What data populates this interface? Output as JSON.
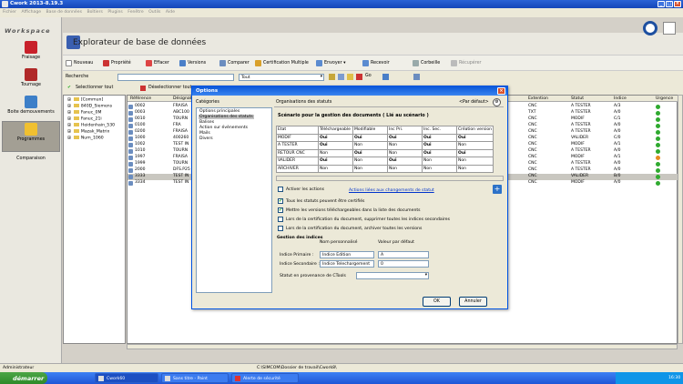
{
  "window": {
    "title": "Cwork 2013-8.19.3"
  },
  "menu": [
    "Fichier",
    "Affichage",
    "Base de données",
    "Boîtiers",
    "Plugins",
    "Fenêtre",
    "Outils",
    "Aide"
  ],
  "sidebar": {
    "workspace_label": "Workspace",
    "items": [
      {
        "label": "Fraisage",
        "icon": "milling-icon"
      },
      {
        "label": "Tournage",
        "icon": "turning-icon"
      },
      {
        "label": "Boite demouvements",
        "icon": "machine-icon"
      },
      {
        "label": "Programmes",
        "icon": "programs-folder-icon",
        "selected": true
      },
      {
        "label": "Comparaison",
        "icon": "compare-icon"
      }
    ]
  },
  "main": {
    "title": "Explorateur de base de données"
  },
  "toolbar": {
    "nouveau": "Nouveau",
    "propriete": "Propriété",
    "effacer": "Effacer",
    "versions": "Versions",
    "comparer": "Comparer",
    "certification": "Certification Multiple",
    "envoyer": "Envoyer",
    "recevoir": "Recevoir",
    "corbeille": "Corbeille",
    "recuperer": "Récupérer"
  },
  "search": {
    "label": "Recherche",
    "filter_value": "Tout",
    "go_label": "Go"
  },
  "selection": {
    "select_all": "Selectionner tout",
    "deselect_all": "Déselectionner tout"
  },
  "tree": [
    "[Commun]",
    "840D_Siemens",
    "Fanuc_0M",
    "Fanuc_21i",
    "Heidenhain_530",
    "Mazak_Matrix",
    "Num_1060"
  ],
  "grid": {
    "columns": {
      "reference": "Référence",
      "designation": "Désignati",
      "extension": "Extention",
      "statut": "Statut",
      "indice": "Indice",
      "urgence": "Urgence"
    },
    "rows": [
      {
        "ref": "0002",
        "des": "FRAISA",
        "ext": "CNC",
        "statut": "A TESTER",
        "indice": "A/3",
        "urg": "#2faa2f"
      },
      {
        "ref": "0003",
        "des": "ABC100",
        "ext": "TXT",
        "statut": "A TESTER",
        "indice": "A/0",
        "urg": "#2faa2f"
      },
      {
        "ref": "0010",
        "des": "TOURN",
        "ext": "CNC",
        "statut": "MODIF",
        "indice": "C/1",
        "urg": "#2faa2f"
      },
      {
        "ref": "0100",
        "des": "FRA",
        "ext": "CNC",
        "statut": "A TESTER",
        "indice": "A/0",
        "urg": "#2faa2f"
      },
      {
        "ref": "0200",
        "des": "FRAISA",
        "ext": "CNC",
        "statut": "A TESTER",
        "indice": "A/0",
        "urg": "#2faa2f"
      },
      {
        "ref": "1000",
        "des": "400260",
        "ext": "CNC",
        "statut": "VALIDER",
        "indice": "C/0",
        "urg": "#2faa2f"
      },
      {
        "ref": "1002",
        "des": "TEST IN",
        "ext": "CNC",
        "statut": "MODIF",
        "indice": "A/1",
        "urg": "#2faa2f"
      },
      {
        "ref": "1010",
        "des": "TOURN",
        "ext": "CNC",
        "statut": "A TESTER",
        "indice": "A/0",
        "urg": "#2faa2f"
      },
      {
        "ref": "1997",
        "des": "FRAISA",
        "ext": "CNC",
        "statut": "MODIF",
        "indice": "A/1",
        "urg": "#e68a1f"
      },
      {
        "ref": "1999",
        "des": "TOURN",
        "ext": "CNC",
        "statut": "A TESTER",
        "indice": "A/0",
        "urg": "#2faa2f"
      },
      {
        "ref": "2000",
        "des": "DFS.P25",
        "ext": "CNC",
        "statut": "A TESTER",
        "indice": "A/0",
        "urg": "#2faa2f"
      },
      {
        "ref": "3333",
        "des": "TEST IN",
        "ext": "CNC",
        "statut": "VALIDER",
        "indice": "B/0",
        "urg": "#2faa2f"
      },
      {
        "ref": "3334",
        "des": "TEST IN",
        "ext": "CNC",
        "statut": "MODIF",
        "indice": "A/0",
        "urg": "#2faa2f"
      }
    ]
  },
  "status": {
    "user": "Administrateur",
    "path": "C:\\SIMCOM\\Dossier de travail\\Cwork8\\"
  },
  "taskbar": {
    "start": "démarrer",
    "tasks": [
      "Cwork60",
      "Sans titre - Paint",
      "Alerte de sécurité"
    ],
    "clock": "16:30"
  },
  "dialog": {
    "title": "Options",
    "categories_label": "Catégories",
    "categories": [
      "Options principales",
      "Organisations des statuts",
      "Balises",
      "Action sur évènements",
      "Mails",
      "Divers"
    ],
    "selected_category": 1,
    "panel_title": "Organisations des statuts",
    "par_defaut": "<Par défaut>",
    "section_header": "Scénario pour la gestion des documents ( Lié au scénario )",
    "table": {
      "headers": [
        "Etat",
        "Téléchargeable",
        "Modifiable",
        "Inc Pri.",
        "Inc. Sec.",
        "Création version"
      ],
      "rows": [
        [
          "MODIF",
          "Oui",
          "Oui",
          "Oui",
          "Oui",
          "Oui"
        ],
        [
          "A TESTER",
          "Oui",
          "Non",
          "Non",
          "Oui",
          "Non"
        ],
        [
          "RETOUR CNC",
          "Non",
          "Oui",
          "Non",
          "Oui",
          "Oui"
        ],
        [
          "VALIDER",
          "Oui",
          "Non",
          "Oui",
          "Non",
          "Non"
        ],
        [
          "ARCHIVER",
          "Non",
          "Non",
          "Non",
          "Non",
          "Non"
        ]
      ]
    },
    "activer_actions": "Activer les actions",
    "actions_link": "Actions liées aux changements de statut",
    "options": [
      {
        "label": "Tous les statuts peuvent être certifiés",
        "checked": true
      },
      {
        "label": "Mettre les versions téléchargeables dans la liste des documents",
        "checked": true
      },
      {
        "label": "Lors de la certification du document, supprimer toutes les indices secondaires",
        "checked": false
      },
      {
        "label": "Lors de la certification du document, archiver toutes les versions",
        "checked": false
      }
    ],
    "indices": {
      "header": "Gestion des indices",
      "col_nom": "Nom personnalisé",
      "col_val": "Valeur par défaut",
      "primaire_label": "Indice Primaire :",
      "primaire_nom": "Indice Edition",
      "primaire_val": "A",
      "secondaire_label": "Indice Secondaire :",
      "secondaire_nom": "Indice Telechargement",
      "secondaire_val": "0",
      "provenance_label": "Statut en provenance de CTools"
    },
    "ok": "OK",
    "annuler": "Annuler"
  }
}
